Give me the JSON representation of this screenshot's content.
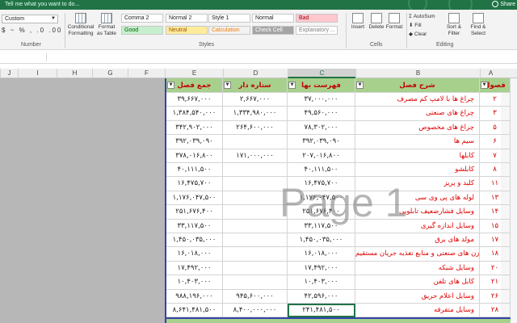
{
  "tell_me": "Tell me what you want to do...",
  "user_label": "Share",
  "ribbon": {
    "number_format": "Custom",
    "number_icons": "$ ~ % , .0 .00",
    "conditional_formatting": "Conditional Formatting",
    "format_as_table": "Format as Table",
    "styles": [
      {
        "label": "Comma 2",
        "bg": "#ffffff",
        "fg": "#222222"
      },
      {
        "label": "Normal 2",
        "bg": "#ffffff",
        "fg": "#222222"
      },
      {
        "label": "Style 1",
        "bg": "#ffffff",
        "fg": "#222222"
      },
      {
        "label": "Normal",
        "bg": "#ffffff",
        "fg": "#222222"
      },
      {
        "label": "Bad",
        "bg": "#ffc7ce",
        "fg": "#9c0006"
      },
      {
        "label": "Good",
        "bg": "#c6efce",
        "fg": "#006100"
      },
      {
        "label": "Neutral",
        "bg": "#ffeb9c",
        "fg": "#9c5700"
      },
      {
        "label": "Calculation",
        "bg": "#f2f2f2",
        "fg": "#fa7d00"
      },
      {
        "label": "Check Cell",
        "bg": "#a5a5a5",
        "fg": "#ffffff"
      },
      {
        "label": "Explanatory ...",
        "bg": "#ffffff",
        "fg": "#7f7f7f"
      }
    ],
    "insert": "Insert",
    "delete": "Delete",
    "format": "Format",
    "autosum": "AutoSum",
    "fill": "Fill",
    "clear": "Clear",
    "sort_filter": "Sort & Filter",
    "find_select": "Find & Select",
    "group_number": "Number",
    "group_styles": "Styles",
    "group_cells": "Cells",
    "group_editing": "Editing"
  },
  "columns": [
    "J",
    "I",
    "H",
    "G",
    "F",
    "E",
    "D",
    "C",
    "B",
    "A"
  ],
  "selected_column": "C",
  "table": {
    "headers": {
      "total": "جمع فصل",
      "star": "ستاره دار",
      "list": "فهرست بها",
      "desc": "شرح فصل",
      "idx": "فصول"
    },
    "rows": [
      {
        "total": "۳۹,۶۶۷,۰۰۰",
        "star": "۲,۶۶۷,۰۰۰",
        "list": "۳۷,۰۰۰,۰۰۰",
        "desc": "چراغ ها با لامپ کم مصرف",
        "idx": "۲"
      },
      {
        "total": "۱,۳۸۴,۵۴۰,۰۰۰",
        "star": "۱,۳۳۴,۹۸۰,۰۰۰",
        "list": "۴۹,۵۶۰,۰۰۰",
        "desc": "چراغ های صنعتی",
        "idx": "۳"
      },
      {
        "total": "۳۴۲,۹۰۲,۰۰۰",
        "star": "۲۶۴,۶۰۰,۰۰۰",
        "list": "۷۸,۳۰۲,۰۰۰",
        "desc": "چراغ های مخصوص",
        "idx": "۵"
      },
      {
        "total": "۳۹۲,۰۳۹,۰۹۰",
        "star": "",
        "list": "۳۹۲,۰۳۹,۰۹۰",
        "desc": "سیم ها",
        "idx": "۶"
      },
      {
        "total": "۳۷۸,۰۱۶,۸۰۰",
        "star": "۱۷۱,۰۰۰,۰۰۰",
        "list": "۲۰۷,۰۱۶,۸۰۰",
        "desc": "کابلها",
        "idx": "۷"
      },
      {
        "total": "۴۰,۱۱۱,۵۰۰",
        "star": "",
        "list": "۴۰,۱۱۱,۵۰۰",
        "desc": "کابلشو",
        "idx": "۸"
      },
      {
        "total": "۱۶,۴۷۵,۷۰۰",
        "star": "",
        "list": "۱۶,۴۷۵,۷۰۰",
        "desc": "کلید و پریز",
        "idx": "۱۱"
      },
      {
        "total": "۱,۱۷۶,۰۴۷,۵۰۰",
        "star": "",
        "list": "۱,۱۷۶,۰۴۷,۵۰۰",
        "desc": "لوله های پی وی سی",
        "idx": "۱۳"
      },
      {
        "total": "۲۵۱,۶۷۶,۴۰۰",
        "star": "",
        "list": "۲۵۱,۶۷۶,۴۰۰",
        "desc": "وسایل فشارضعیف تابلویی",
        "idx": "۱۴"
      },
      {
        "total": "۳۳,۱۱۷,۵۰۰",
        "star": "",
        "list": "۳۳,۱۱۷,۵۰۰",
        "desc": "وسایل اندازه گیری",
        "idx": "۱۵"
      },
      {
        "total": "۱,۴۵۰,۰۳۵,۰۰۰",
        "star": "",
        "list": "۱,۴۵۰,۰۳۵,۰۰۰",
        "desc": "مولد های برق",
        "idx": "۱۷"
      },
      {
        "total": "۱۶,۰۱۸,۰۰۰",
        "star": "",
        "list": "۱۶,۰۱۸,۰۰۰",
        "desc": "خازن های صنعتی و منابع تغذیه جریان مستقیم",
        "idx": "۱۸"
      },
      {
        "total": "۱۷,۴۹۲,۰۰۰",
        "star": "",
        "list": "۱۷,۴۹۲,۰۰۰",
        "desc": "وسایل شبکه",
        "idx": "۲۰"
      },
      {
        "total": "۱۰,۴۰۳,۰۰۰",
        "star": "",
        "list": "۱۰,۴۰۳,۰۰۰",
        "desc": "کابل های تلفن",
        "idx": "۲۱"
      },
      {
        "total": "۹۸۸,۱۹۶,۰۰۰",
        "star": "۹۴۵,۶۰۰,۰۰۰",
        "list": "۴۲,۵۹۶,۰۰۰",
        "desc": "وسایل اعلام حریق",
        "idx": "۲۶"
      },
      {
        "total": "۸,۶۴۱,۴۸۱,۵۰۰",
        "star": "۸,۴۰۰,۰۰۰,۰۰۰",
        "list": "۲۴۱,۴۸۱,۵۰۰",
        "desc": "وسایل متفرقه",
        "idx": "۲۸"
      }
    ]
  },
  "watermark": "Page 1"
}
